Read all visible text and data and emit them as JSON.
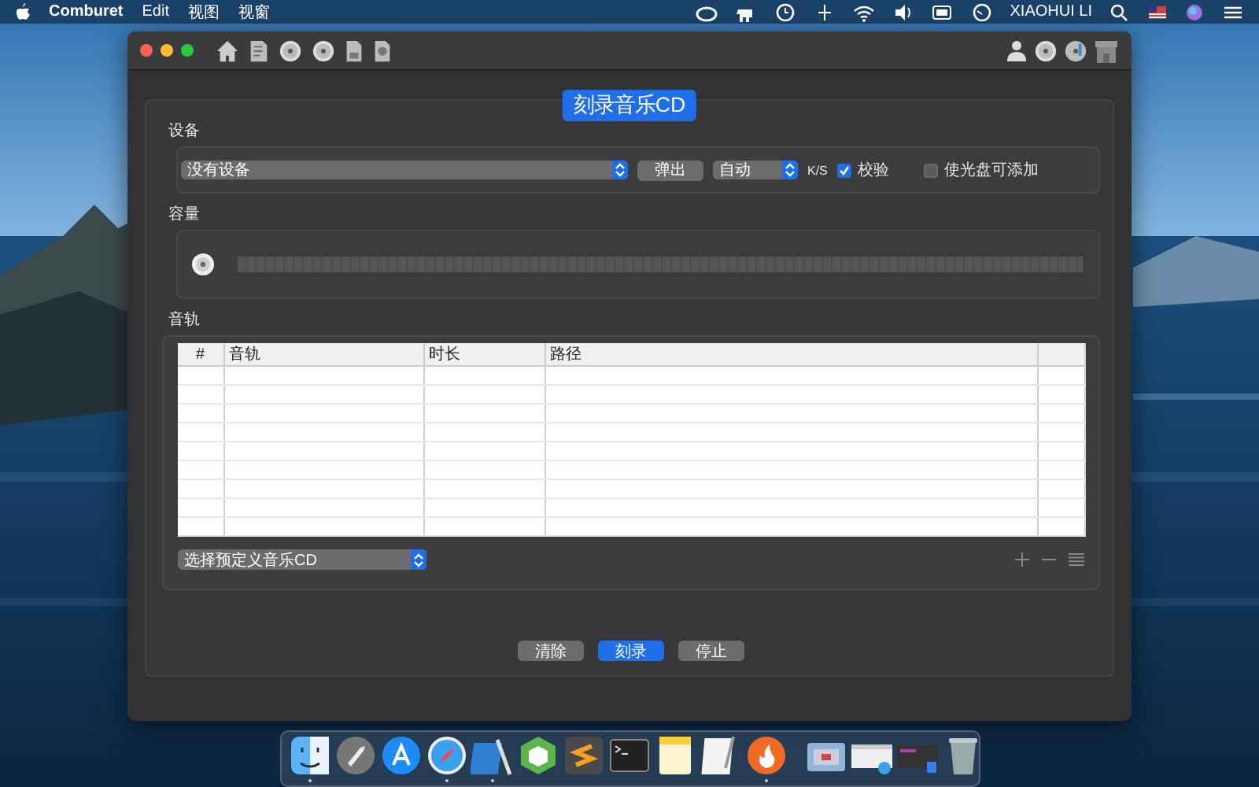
{
  "menu_bar": {
    "app_name": "Comburet",
    "menus": [
      "Edit",
      "视图",
      "视窗"
    ],
    "user": "XIAOHUI LI"
  },
  "window": {
    "tab": "刻录音乐CD",
    "device": {
      "label": "设备",
      "drive": {
        "value": "没有设备"
      },
      "eject_button": "弹出",
      "speed": {
        "value": "自动"
      },
      "speed_unit": "K/S",
      "verify": {
        "label": "校验",
        "checked": true
      },
      "appendable": {
        "label": "使光盘可添加",
        "checked": false
      }
    },
    "capacity": {
      "label": "容量",
      "level": 0
    },
    "tracks": {
      "label": "音轨",
      "columns": [
        "#",
        "音轨",
        "时长",
        "路径"
      ],
      "preset": {
        "value": "选择预定义音乐CD"
      }
    },
    "buttons": [
      {
        "label": "清除",
        "primary": false
      },
      {
        "label": "刻录",
        "primary": true
      },
      {
        "label": "停止",
        "primary": false
      }
    ]
  },
  "dock": {
    "apps": [
      {
        "running": true
      },
      {
        "running": false
      },
      {
        "running": false
      },
      {
        "running": true
      },
      {
        "running": true
      },
      {
        "running": false
      },
      {
        "running": false
      },
      {
        "running": false
      },
      {
        "running": false
      },
      {
        "running": false
      },
      {
        "running": true
      }
    ]
  }
}
